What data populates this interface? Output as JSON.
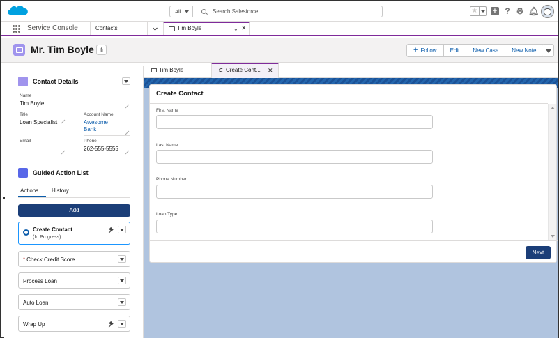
{
  "search": {
    "scope": "All",
    "placeholder": "Search Salesforce"
  },
  "nav": {
    "app_name": "Service Console",
    "object": "Contacts",
    "workspace_tab": "Tim Boyle"
  },
  "header": {
    "title": "Mr. Tim Boyle"
  },
  "actions": {
    "follow": "Follow",
    "edit": "Edit",
    "new_case": "New Case",
    "new_note": "New Note"
  },
  "contact_details": {
    "title": "Contact Details",
    "name_label": "Name",
    "name": "Tim Boyle",
    "title_label": "Title",
    "title_value": "Loan Specialist",
    "account_label": "Account Name",
    "account_line1": "Awesome",
    "account_line2": "Bank",
    "email_label": "Email",
    "email": "",
    "phone_label": "Phone",
    "phone": "262-555-5555"
  },
  "guided": {
    "title": "Guided Action List",
    "tab_actions": "Actions",
    "tab_history": "History",
    "add_label": "Add",
    "items": [
      {
        "label": "Create Contact",
        "status": "(In Progress)"
      },
      {
        "label": "Check Credit Score",
        "required": "*"
      },
      {
        "label": "Process Loan"
      },
      {
        "label": "Auto Loan"
      },
      {
        "label": "Wrap Up"
      }
    ]
  },
  "subtabs": {
    "tab1": "Tim Boyle",
    "tab2": "Create Cont..."
  },
  "form": {
    "title": "Create Contact",
    "fields": [
      "First Name",
      "Last Name",
      "Phone Number",
      "Loan Type"
    ],
    "next_label": "Next"
  },
  "colors": {
    "accent": "#7f2b9a",
    "brand_button": "#1b3e78",
    "link": "#0b5cab",
    "logo": "#00a1e0"
  }
}
